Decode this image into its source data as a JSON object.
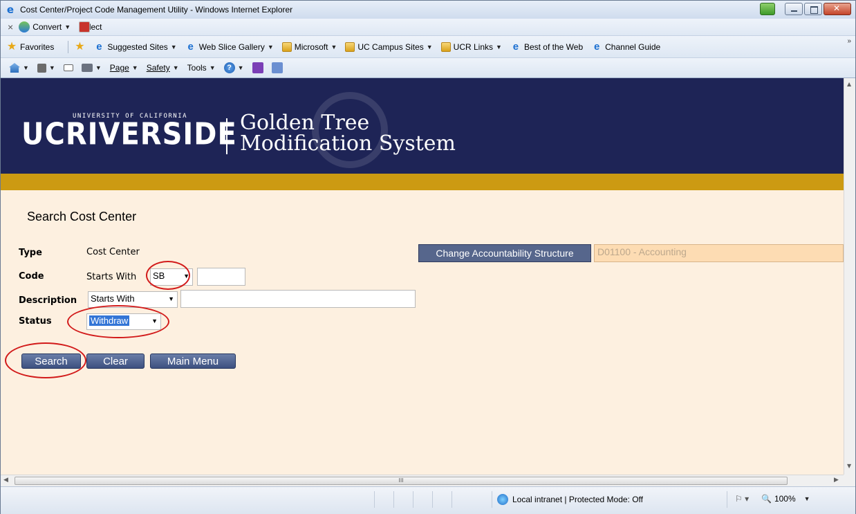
{
  "window": {
    "title": "Cost Center/Project Code Management Utility - Windows Internet Explorer"
  },
  "addon_bar": {
    "convert_label": "Convert",
    "select_label": "Select"
  },
  "favorites_bar": {
    "favorites_label": "Favorites",
    "items": [
      {
        "label": "Suggested Sites",
        "icon": "ie-icon",
        "dropdown": true
      },
      {
        "label": "Web Slice Gallery",
        "icon": "ie-icon",
        "dropdown": true
      },
      {
        "label": "Microsoft",
        "icon": "folder-icon",
        "dropdown": true
      },
      {
        "label": "UC Campus Sites",
        "icon": "folder-icon",
        "dropdown": true
      },
      {
        "label": "UCR Links",
        "icon": "folder-icon",
        "dropdown": true
      },
      {
        "label": "Best of the Web",
        "icon": "ie-icon",
        "dropdown": false
      },
      {
        "label": "Channel Guide",
        "icon": "ie-icon",
        "dropdown": false
      }
    ]
  },
  "command_bar": {
    "page_label": "Page",
    "safety_label": "Safety",
    "tools_label": "Tools"
  },
  "banner": {
    "logo_uc": "UCRIVERSIDE",
    "logo_small": "UNIVERSITY OF CALIFORNIA",
    "title_line1": "Golden Tree",
    "title_line2": "Modification System",
    "background": "#1e2456",
    "stripe": "#cc9a12"
  },
  "form": {
    "heading": "Search Cost Center",
    "type_label": "Type",
    "type_value": "Cost Center",
    "code_label": "Code",
    "code_match": "Starts With",
    "code_prefix": "SB",
    "code_value": "",
    "description_label": "Description",
    "description_match": "Starts With",
    "description_value": "",
    "status_label": "Status",
    "status_value": "Withdraw",
    "change_structure_label": "Change Accountability Structure",
    "structure_value": "D01100 - Accounting",
    "buttons": {
      "search": "Search",
      "clear": "Clear",
      "main_menu": "Main Menu"
    }
  },
  "status_bar": {
    "zone": "Local intranet | Protected Mode: Off",
    "zoom": "100%"
  },
  "scrollbar": {
    "grip": "III"
  },
  "colors": {
    "page_bg": "#fdf0e0",
    "button": "#4a5d8c",
    "annotation": "#d21a1a"
  }
}
